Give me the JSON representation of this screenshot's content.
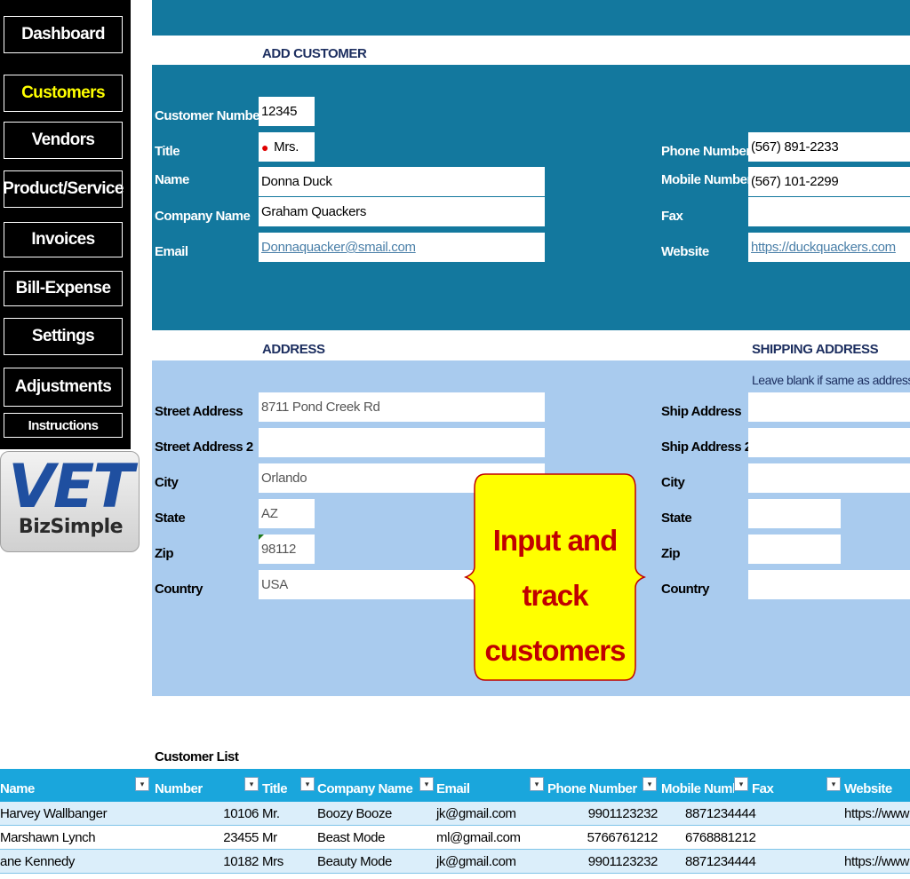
{
  "sidebar": {
    "items": [
      {
        "label": "Dashboard",
        "active": false
      },
      {
        "label": "Customers",
        "active": true
      },
      {
        "label": "Vendors",
        "active": false
      },
      {
        "label": "Product/Service",
        "active": false
      },
      {
        "label": "Invoices",
        "active": false
      },
      {
        "label": "Bill-Expense",
        "active": false
      },
      {
        "label": "Settings",
        "active": false
      },
      {
        "label": "Adjustments",
        "active": false
      },
      {
        "label": "Instructions",
        "active": false
      }
    ],
    "logo": {
      "main": "VET",
      "sub": "BizSimple"
    }
  },
  "add_customer": {
    "title": "ADD CUSTOMER",
    "labels": {
      "customer_number": "Customer Number",
      "title": "Title",
      "name": "Name",
      "company": "Company Name",
      "email": "Email",
      "phone": "Phone Number",
      "mobile": "Mobile Number",
      "fax": "Fax",
      "website": "Website"
    },
    "values": {
      "customer_number": "12345",
      "title": "Mrs.",
      "name": "Donna Duck",
      "company": "Graham Quackers",
      "email": "Donnaquacker@smail.com",
      "phone": "(567) 891-2233",
      "mobile": "(567) 101-2299",
      "fax": "",
      "website": "https://duckquackers.com"
    }
  },
  "address": {
    "title": "ADDRESS",
    "labels": {
      "street": "Street Address",
      "street2": "Street Address 2",
      "city": "City",
      "state": "State",
      "zip": "Zip",
      "country": "Country"
    },
    "values": {
      "street": "8711 Pond Creek Rd",
      "street2": "",
      "city": "Orlando",
      "state": "AZ",
      "zip": "98112",
      "country": "USA"
    }
  },
  "shipping": {
    "title": "SHIPPING ADDRESS",
    "note": "Leave blank if same as address",
    "labels": {
      "ship_address": "Ship Address",
      "ship_address2": "Ship Address 2",
      "city": "City",
      "state": "State",
      "zip": "Zip",
      "country": "Country"
    }
  },
  "callout": {
    "line1": "Input and",
    "line2": "track",
    "line3": "customers"
  },
  "customer_list": {
    "title": "Customer List",
    "columns": [
      "Name",
      "Number",
      "Title",
      "Company Name",
      "Email",
      "Phone Number",
      "Mobile Numbe",
      "Fax",
      "Website"
    ],
    "rows": [
      {
        "name": "Harvey Wallbanger",
        "number": "10106",
        "title": "Mr.",
        "company": "Boozy Booze",
        "email": "jk@gmail.com",
        "phone": "9901123232",
        "mobile": "8871234444",
        "fax": "",
        "website": "https://www"
      },
      {
        "name": "Marshawn Lynch",
        "number": "23455",
        "title": "Mr",
        "company": "Beast Mode",
        "email": "ml@gmail.com",
        "phone": "5766761212",
        "mobile": "6768881212",
        "fax": "",
        "website": ""
      },
      {
        "name": "ane Kennedy",
        "number": "10182",
        "title": "Mrs",
        "company": "Beauty Mode",
        "email": "jk@gmail.com",
        "phone": "9901123232",
        "mobile": "8871234444",
        "fax": "",
        "website": "https://www"
      }
    ]
  },
  "colors": {
    "panel_dark": "#13789e",
    "panel_light": "#a9cbee",
    "table_header": "#1aa6dc",
    "active_nav": "#ffff00"
  }
}
